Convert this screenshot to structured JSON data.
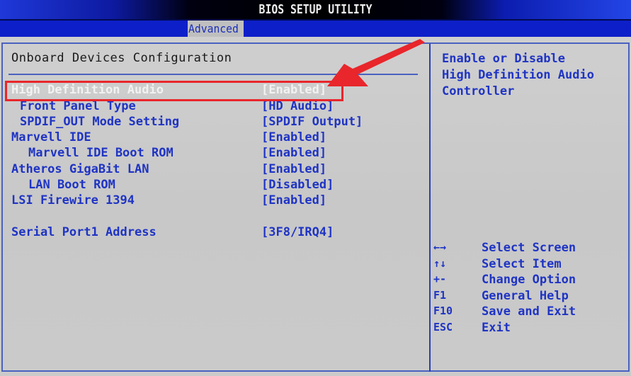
{
  "window": {
    "title": "BIOS SETUP UTILITY"
  },
  "tabs": [
    {
      "label": "Advanced",
      "active": true
    }
  ],
  "main": {
    "section_title": "Onboard Devices Configuration",
    "items": [
      {
        "label": "High Definition Audio",
        "value": "[Enabled]",
        "indent": 0,
        "selected": true
      },
      {
        "label": "Front Panel Type",
        "value": "[HD Audio]",
        "indent": 1,
        "selected": false
      },
      {
        "label": "SPDIF_OUT Mode Setting",
        "value": "[SPDIF Output]",
        "indent": 1,
        "selected": false
      },
      {
        "label": "Marvell IDE",
        "value": "[Enabled]",
        "indent": 0,
        "selected": false
      },
      {
        "label": "Marvell IDE Boot ROM",
        "value": "[Enabled]",
        "indent": 2,
        "selected": false
      },
      {
        "label": "Atheros GigaBit LAN",
        "value": "[Enabled]",
        "indent": 0,
        "selected": false
      },
      {
        "label": "LAN Boot ROM",
        "value": "[Disabled]",
        "indent": 2,
        "selected": false
      },
      {
        "label": "LSI Firewire 1394",
        "value": "[Enabled]",
        "indent": 0,
        "selected": false
      },
      {
        "label": "Serial Port1 Address",
        "value": "[3F8/IRQ4]",
        "indent": 0,
        "selected": false
      }
    ]
  },
  "help": {
    "text": "Enable or Disable\nHigh Definition Audio\nController"
  },
  "keys": [
    {
      "key": "←→",
      "desc": "Select Screen"
    },
    {
      "key": "↑↓",
      "desc": "Select Item"
    },
    {
      "key": "+-",
      "desc": "Change Option"
    },
    {
      "key": "F1",
      "desc": "General Help"
    },
    {
      "key": "F10",
      "desc": "Save and Exit"
    },
    {
      "key": "ESC",
      "desc": "Exit"
    }
  ],
  "annotation": {
    "color": "#e8262b",
    "target": "High Definition Audio"
  },
  "colors": {
    "text_blue": "#1f34c4",
    "selected_text": "#f2f2f2",
    "background": "#c9c9c9",
    "tabbar": "#0d1fc8"
  }
}
